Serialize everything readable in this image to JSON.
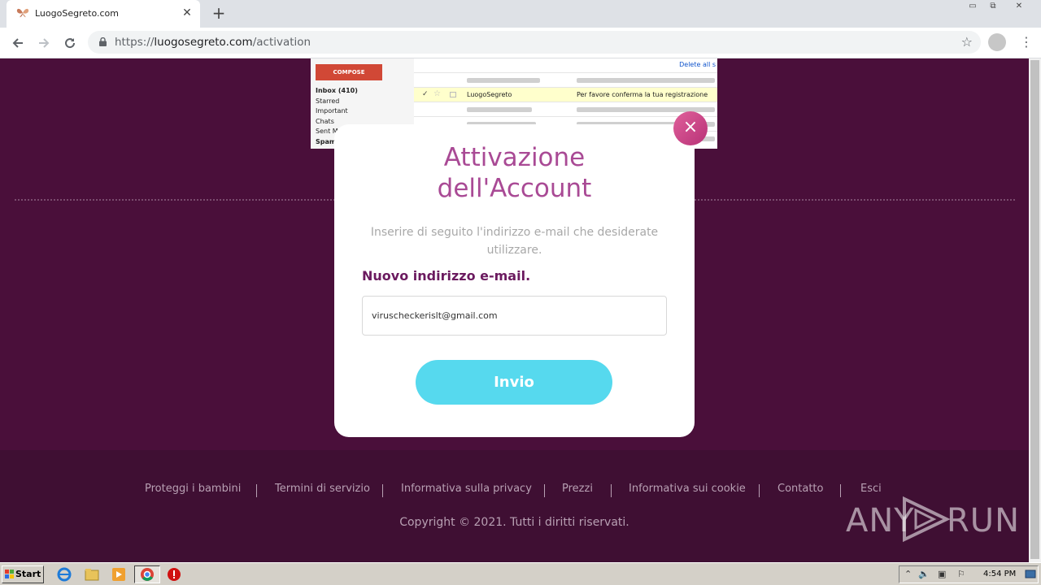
{
  "browser": {
    "tab_title": "LuogoSegreto.com",
    "tab_close": "✕",
    "new_tab": "+",
    "url_prefix": "https://",
    "url_host": "luogosegreto.com",
    "url_path": "/activation"
  },
  "window_controls": [
    "▭",
    "⧉",
    "✕"
  ],
  "background_preview": {
    "compose": "COMPOSE",
    "folders": [
      "Inbox (410)",
      "Starred",
      "Important",
      "Chats",
      "Sent M",
      "Spam"
    ],
    "delete_all": "Delete all s",
    "highlighted_row": {
      "sender": "LuogoSegreto",
      "subject": "Per favore conferma la tua registrazione"
    }
  },
  "modal": {
    "title_line1": "Attivazione",
    "title_line2": "dell'Account",
    "close": "×",
    "description": "Inserire di seguito l'indirizzo e-mail che desiderate utilizzare.",
    "field_label": "Nuovo indirizzo e-mail.",
    "email_value": "viruscheckerislt@gmail.com",
    "submit": "Invio"
  },
  "footer": {
    "links": [
      "Proteggi i bambini",
      "Termini di servizio",
      "Informativa sulla privacy",
      "Prezzi",
      "Informativa sui cookie",
      "Contatto",
      "Esci"
    ],
    "copyright": "Copyright © 2021. Tutti i diritti riservati."
  },
  "watermark": {
    "left": "ANY",
    "right": "RUN"
  },
  "taskbar": {
    "start": "Start",
    "clock": "4:54 PM"
  }
}
